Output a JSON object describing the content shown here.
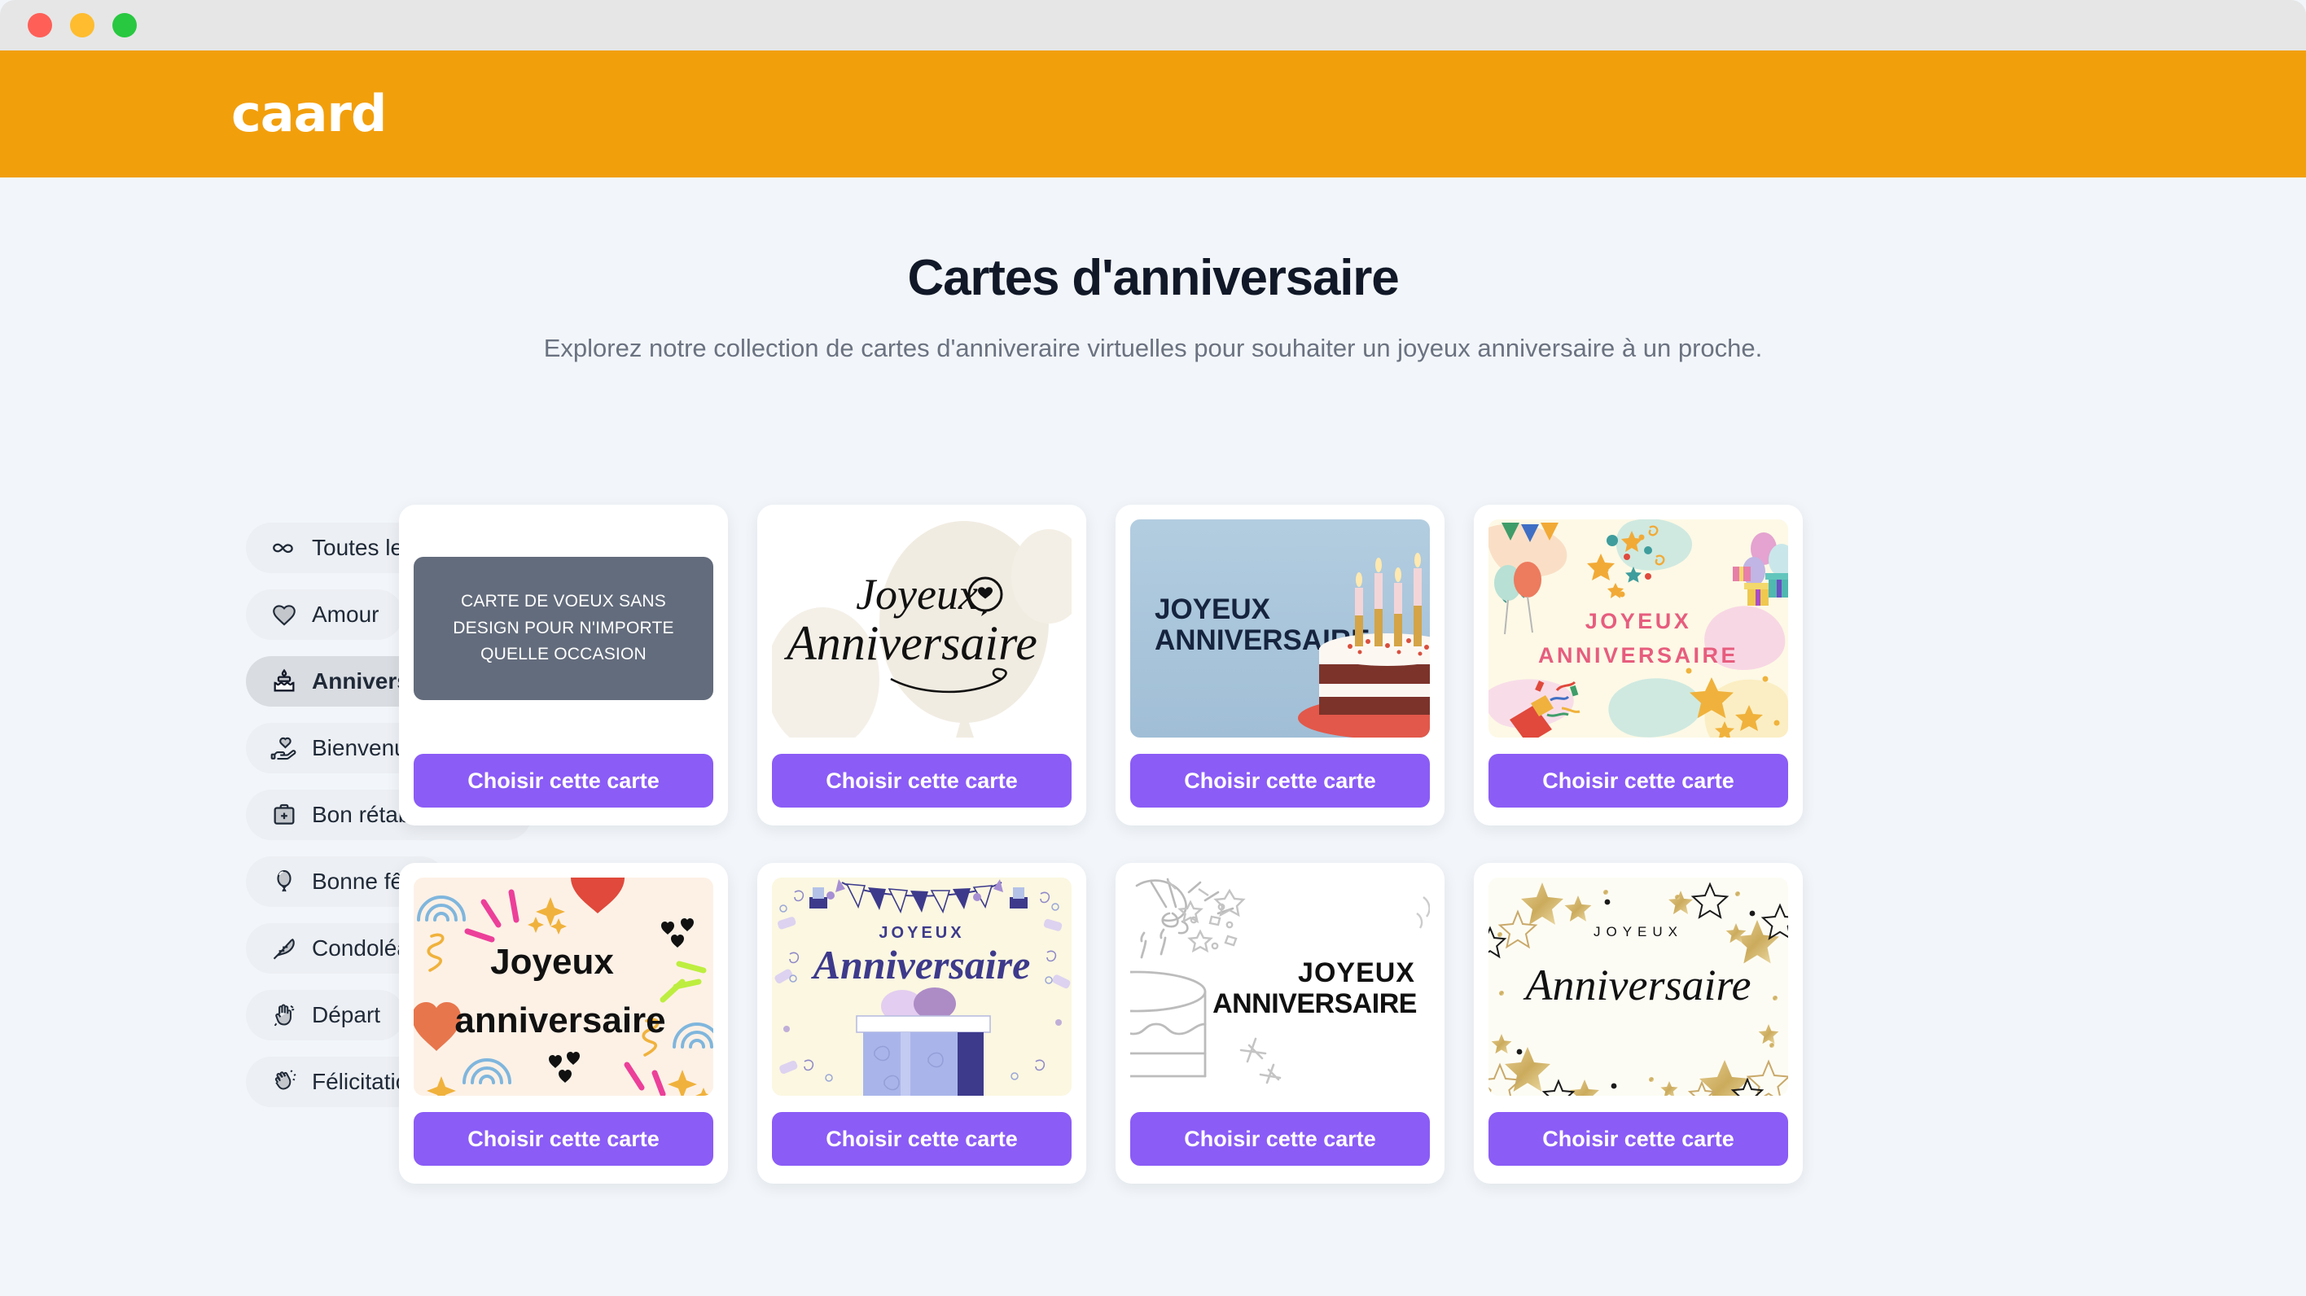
{
  "window": {
    "traffic_lights": [
      "close",
      "minimize",
      "zoom"
    ],
    "colors": {
      "titlebar": "#e6e6e6",
      "close": "#ff5f57",
      "minimize": "#febc2e",
      "zoom": "#28c840"
    }
  },
  "header": {
    "logo": "caard",
    "brand_color": "#f29f0c",
    "logo_color": "#ffffff"
  },
  "page": {
    "title": "Cartes d'anniversaire",
    "subtitle": "Explorez notre collection de cartes d'anniveraire virtuelles pour souhaiter un joyeux anniversaire à un proche.",
    "background": "#f2f6fa",
    "title_color": "#111827",
    "subtitle_color": "#6b7280"
  },
  "sidebar": {
    "active_index": 2,
    "chip_bg": "#eceff3",
    "chip_active_bg": "#d9dde2",
    "items": [
      {
        "label": "Toutes les cartes",
        "icon": "infinity-icon",
        "active": false
      },
      {
        "label": "Amour",
        "icon": "heart-icon",
        "active": false
      },
      {
        "label": "Anniversaire",
        "icon": "birthday-cake-icon",
        "active": true
      },
      {
        "label": "Bienvenue",
        "icon": "hand-holding-heart-icon",
        "active": false
      },
      {
        "label": "Bon rétablissement",
        "icon": "medical-kit-icon",
        "active": false
      },
      {
        "label": "Bonne fête",
        "icon": "balloon-icon",
        "active": false
      },
      {
        "label": "Condoléances",
        "icon": "feather-icon",
        "active": false
      },
      {
        "label": "Départ",
        "icon": "waving-hand-icon",
        "active": false
      },
      {
        "label": "Félicitations",
        "icon": "clapping-hands-icon",
        "active": false
      }
    ]
  },
  "grid": {
    "button_label": "Choisir cette carte",
    "button_color": "#8b5cf6",
    "cards": [
      {
        "id": "blank-card",
        "style": "placeholder",
        "placeholder_text": "CARTE DE VOEUX SANS DESIGN POUR N'IMPORTE QUELLE OCCASION",
        "bg": "#636c7c",
        "button_label": "Choisir cette carte"
      },
      {
        "id": "script-balloons",
        "style": "cream-balloons-script",
        "line1": "Joyeux",
        "line2": "Anniversaire",
        "bg": "#ffffff",
        "accent": "#f0ece3",
        "button_label": "Choisir cette carte"
      },
      {
        "id": "blue-cake-photo",
        "style": "blue-wall-cake",
        "line1": "JOYEUX",
        "line2": "ANNIVERSAIRE",
        "bg": "#a9c6dd",
        "accent": "#16243f",
        "button_label": "Choisir cette carte"
      },
      {
        "id": "pastel-confetti",
        "style": "cream-pastel-blobs",
        "line1": "JOYEUX",
        "line2": "ANNIVERSAIRE",
        "bg": "#fdf8e4",
        "accent": "#e75d7e",
        "button_label": "Choisir cette carte"
      },
      {
        "id": "doodle-hearts",
        "style": "doodle-rainbows",
        "line1": "Joyeux",
        "line2": "anniversaire",
        "bg": "#fdf0e4",
        "accent": "#111111",
        "button_label": "Choisir cette carte"
      },
      {
        "id": "purple-gift",
        "style": "bunting-gift",
        "line1": "JOYEUX",
        "line2": "Anniversaire",
        "bg": "#fbf7e1",
        "accent": "#3d3a8c",
        "button_label": "Choisir cette carte"
      },
      {
        "id": "line-art-cake",
        "style": "white-line-art",
        "line1": "JOYEUX",
        "line2": "ANNIVERSAIRE",
        "bg": "#ffffff",
        "accent": "#111111",
        "button_label": "Choisir cette carte"
      },
      {
        "id": "gold-stars",
        "style": "gold-stars-script",
        "line1": "JOYEUX",
        "line2": "Anniversaire",
        "bg": "#fdfcf4",
        "accent": "#111111",
        "button_label": "Choisir cette carte"
      }
    ]
  }
}
